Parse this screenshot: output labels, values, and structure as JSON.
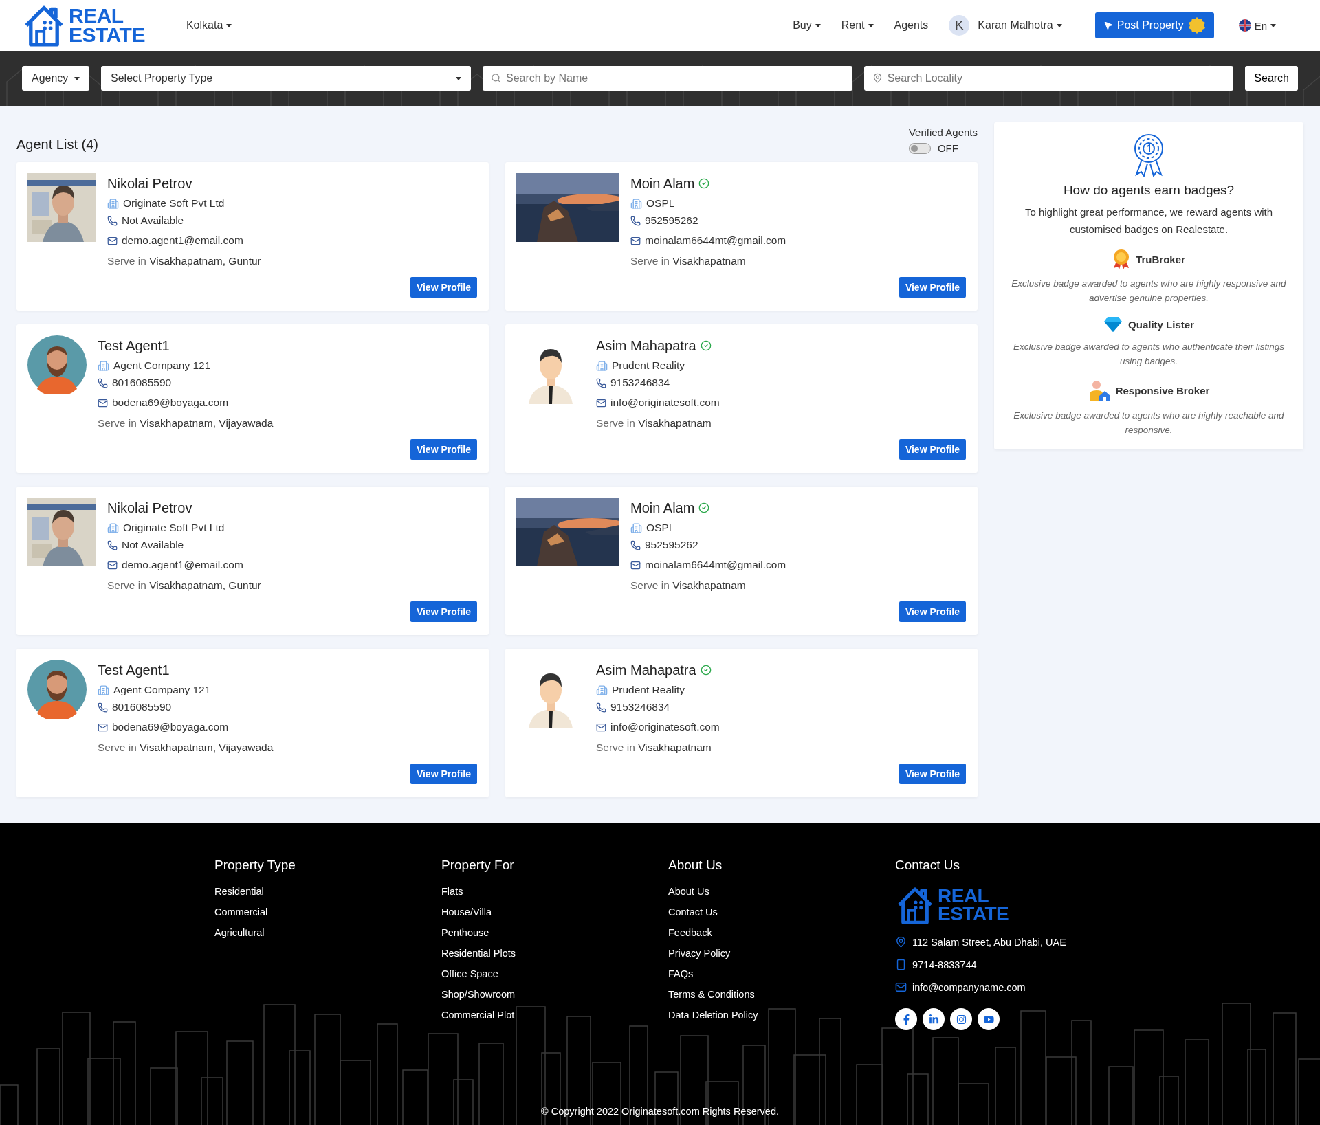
{
  "header": {
    "logo": {
      "line1": "REAL",
      "line2": "ESTATE"
    },
    "city": "Kolkata",
    "nav": [
      {
        "label": "Buy",
        "dropdown": true
      },
      {
        "label": "Rent",
        "dropdown": true
      },
      {
        "label": "Agents",
        "dropdown": false
      }
    ],
    "user": {
      "initial": "K",
      "name": "Karan Malhotra"
    },
    "post_button": "Post Property",
    "language": "En"
  },
  "search_bar": {
    "agency": "Agency",
    "property_type": {
      "placeholder": "Select Property Type"
    },
    "name_search": {
      "placeholder": "Search by Name"
    },
    "locality_search": {
      "placeholder": "Search Locality"
    },
    "button": "Search"
  },
  "agent_list": {
    "title": "Agent List (4)",
    "verified_filter": {
      "label": "Verified Agents",
      "on": false,
      "state_text": "OFF"
    },
    "agents": [
      {
        "name": "Nikolai Petrov",
        "verified": false,
        "company": "Originate Soft Pvt Ltd",
        "phone": "Not Available",
        "email": "demo.agent1@email.com",
        "serve_label": "Serve in",
        "serve_places": "Visakhapatnam, Guntur",
        "button": "View Profile"
      },
      {
        "name": "Moin Alam",
        "verified": true,
        "company": "OSPL",
        "phone": "952595262",
        "email": "moinalam6644mt@gmail.com",
        "serve_label": "Serve in",
        "serve_places": "Visakhapatnam",
        "button": "View Profile"
      },
      {
        "name": "Test Agent1",
        "verified": false,
        "company": "Agent Company 121",
        "phone": "8016085590",
        "email": "bodena69@boyaga.com",
        "serve_label": "Serve in",
        "serve_places": "Visakhapatnam, Vijayawada",
        "button": "View Profile"
      },
      {
        "name": "Asim Mahapatra",
        "verified": true,
        "company": "Prudent Reality",
        "phone": "9153246834",
        "email": "info@originatesoft.com",
        "serve_label": "Serve in",
        "serve_places": "Visakhapatnam",
        "button": "View Profile"
      },
      {
        "name": "Nikolai Petrov",
        "verified": false,
        "company": "Originate Soft Pvt Ltd",
        "phone": "Not Available",
        "email": "demo.agent1@email.com",
        "serve_label": "Serve in",
        "serve_places": "Visakhapatnam, Guntur",
        "button": "View Profile"
      },
      {
        "name": "Moin Alam",
        "verified": true,
        "company": "OSPL",
        "phone": "952595262",
        "email": "moinalam6644mt@gmail.com",
        "serve_label": "Serve in",
        "serve_places": "Visakhapatnam",
        "button": "View Profile"
      },
      {
        "name": "Test Agent1",
        "verified": false,
        "company": "Agent Company 121",
        "phone": "8016085590",
        "email": "bodena69@boyaga.com",
        "serve_label": "Serve in",
        "serve_places": "Visakhapatnam, Vijayawada",
        "button": "View Profile"
      },
      {
        "name": "Asim Mahapatra",
        "verified": true,
        "company": "Prudent Reality",
        "phone": "9153246834",
        "email": "info@originatesoft.com",
        "serve_label": "Serve in",
        "serve_places": "Visakhapatnam",
        "button": "View Profile"
      }
    ]
  },
  "badges_panel": {
    "title": "How do agents earn badges?",
    "intro": "To highlight great performance, we reward agents with customised badges on Realestate.",
    "badges": [
      {
        "kind": "medal",
        "name": "TruBroker",
        "description": "Exclusive badge awarded to agents who are highly responsive and advertise genuine properties."
      },
      {
        "kind": "diamond",
        "name": "Quality Lister",
        "description": "Exclusive badge awarded to agents who authenticate their listings using badges."
      },
      {
        "kind": "broker",
        "name": "Responsive Broker",
        "description": "Exclusive badge awarded to agents who are highly reachable and responsive."
      }
    ]
  },
  "footer": {
    "columns": [
      {
        "title": "Property Type",
        "links": [
          "Residential",
          "Commercial",
          "Agricultural"
        ]
      },
      {
        "title": "Property For",
        "links": [
          "Flats",
          "House/Villa",
          "Penthouse",
          "Residential Plots",
          "Office Space",
          "Shop/Showroom",
          "Commercial Plot"
        ]
      },
      {
        "title": "About Us",
        "links": [
          "About Us",
          "Contact Us",
          "Feedback",
          "Privacy Policy",
          "FAQs",
          "Terms & Conditions",
          "Data Deletion Policy"
        ]
      }
    ],
    "contact": {
      "title": "Contact Us",
      "logo": {
        "line1": "REAL",
        "line2": "ESTATE"
      },
      "items": [
        {
          "kind": "address",
          "text": "112 Salam Street, Abu Dhabi, UAE"
        },
        {
          "kind": "phone",
          "text": "9714-8833744"
        },
        {
          "kind": "email",
          "text": "info@companyname.com"
        }
      ]
    },
    "copyright": "© Copyright 2022 Originatesoft.com Rights Reserved."
  }
}
